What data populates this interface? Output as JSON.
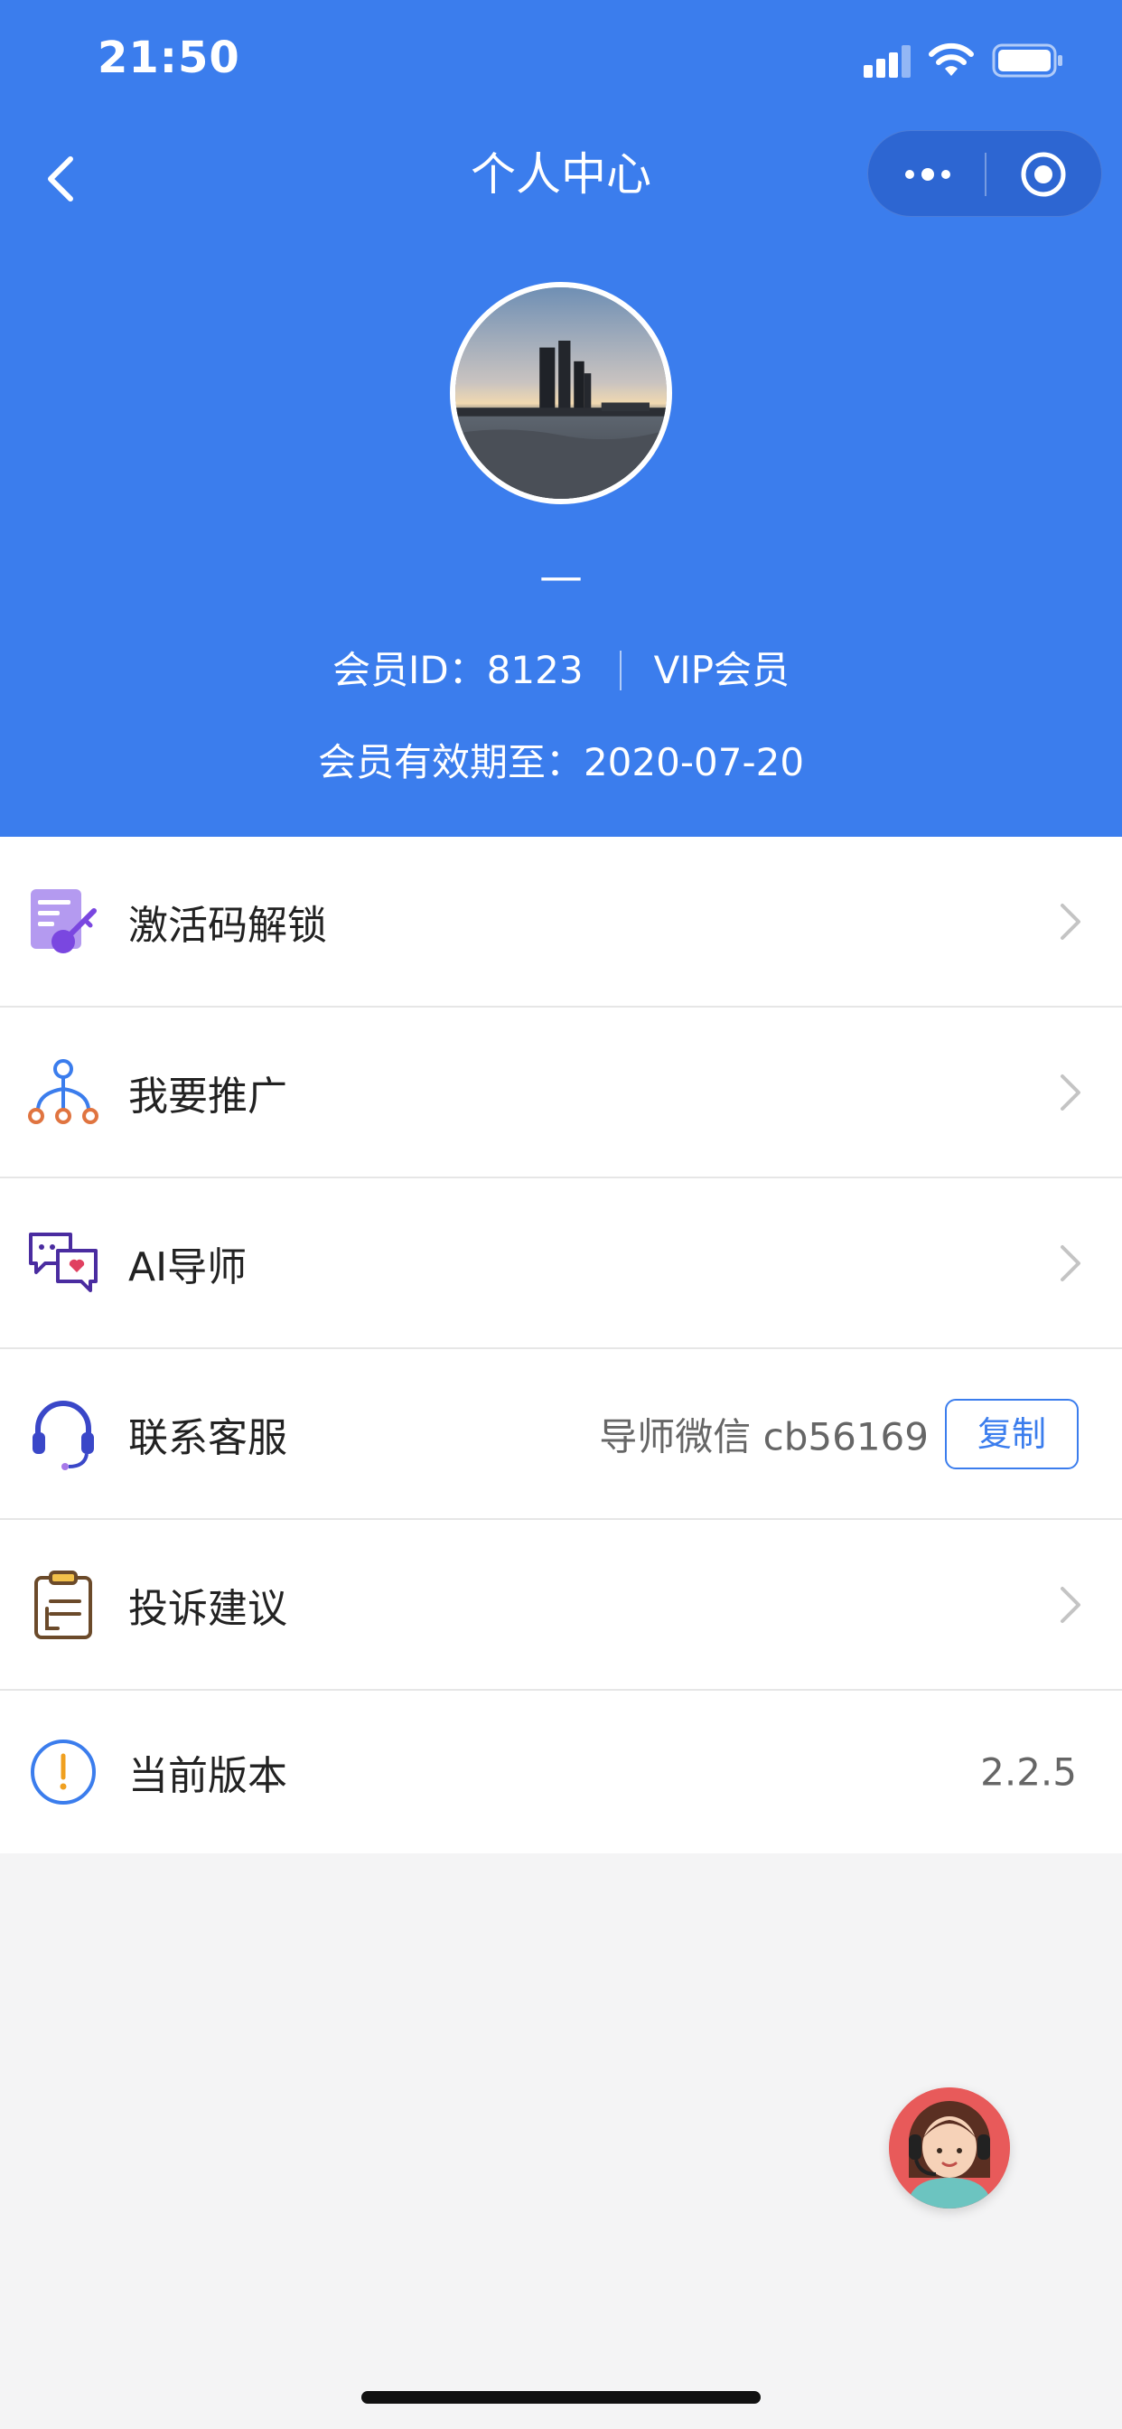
{
  "status_bar": {
    "time": "21:50"
  },
  "nav": {
    "title": "个人中心"
  },
  "profile": {
    "nickname": "—",
    "member_id_text": "会员ID：8123",
    "member_level": "VIP会员",
    "expire_text": "会员有效期至：2020-07-20"
  },
  "menu": [
    {
      "label": "激活码解锁",
      "icon": "key-document-icon"
    },
    {
      "label": "我要推广",
      "icon": "share-network-icon"
    },
    {
      "label": "AI导师",
      "icon": "chat-bubbles-icon"
    },
    {
      "label": "联系客服",
      "icon": "headset-icon",
      "extra": "导师微信 cb56169",
      "button": "复制"
    },
    {
      "label": "投诉建议",
      "icon": "clipboard-icon"
    },
    {
      "label": "当前版本",
      "icon": "info-icon",
      "value": "2.2.5"
    }
  ],
  "colors": {
    "primary": "#3b7ded",
    "background": "#f4f4f5"
  }
}
